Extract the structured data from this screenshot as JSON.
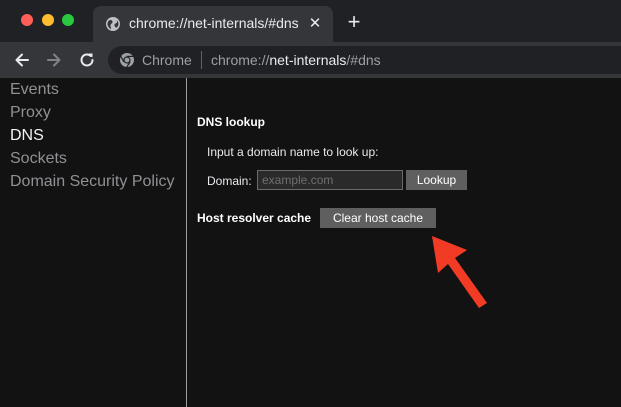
{
  "colors": {
    "arrow": "#f23b24",
    "tab_active": "#35363a",
    "tabstrip": "#202124",
    "content_bg": "#121212"
  },
  "tab": {
    "title": "chrome://net-internals/#dns",
    "close_icon": "close-icon",
    "favicon": "globe-icon"
  },
  "toolbar": {
    "site_chip": "Chrome",
    "url_scheme": "chrome://",
    "url_host": "net-internals",
    "url_path": "/#dns"
  },
  "sidebar": {
    "items": [
      {
        "label": "Events",
        "active": false
      },
      {
        "label": "Proxy",
        "active": false
      },
      {
        "label": "DNS",
        "active": true
      },
      {
        "label": "Sockets",
        "active": false
      },
      {
        "label": "Domain Security Policy",
        "active": false
      }
    ]
  },
  "dns": {
    "lookup_title": "DNS lookup",
    "lookup_prompt": "Input a domain name to look up:",
    "domain_label": "Domain:",
    "domain_value": "",
    "domain_placeholder": "example.com",
    "lookup_button": "Lookup",
    "cache_title": "Host resolver cache",
    "clear_button": "Clear host cache"
  }
}
